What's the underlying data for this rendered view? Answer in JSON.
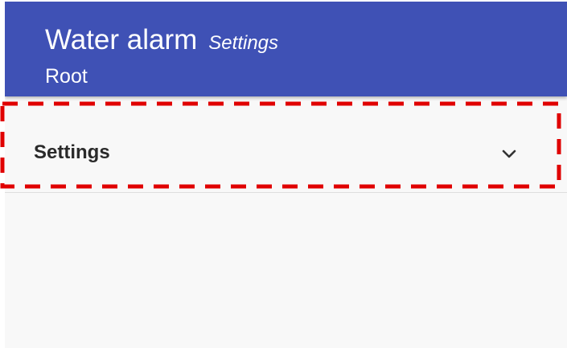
{
  "app_bar": {
    "title": "Water alarm",
    "subtitle": "Settings",
    "breadcrumb": "Root",
    "color": "#3f51b5"
  },
  "settings_row": {
    "label": "Settings",
    "icon": "chevron-down-icon"
  },
  "highlight": {
    "color": "#e00000",
    "style": "dashed"
  }
}
